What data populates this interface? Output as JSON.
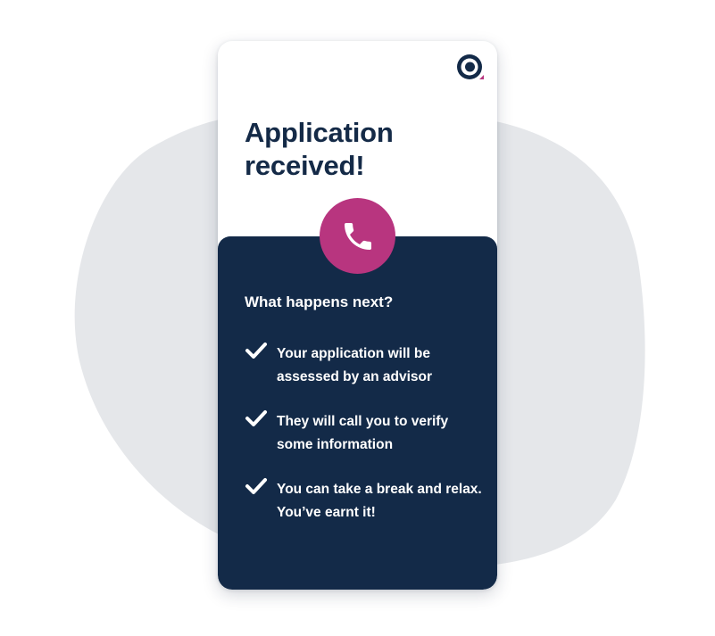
{
  "colors": {
    "navy": "#132a48",
    "title": "#142a47",
    "accent": "#b8357f",
    "blob": "#e5e7ea",
    "white": "#ffffff"
  },
  "app": {
    "logo_icon": "brand-logo-icon"
  },
  "header": {
    "title": "Application received!"
  },
  "badge": {
    "icon": "phone-icon"
  },
  "next": {
    "heading": "What happens next?",
    "steps": [
      {
        "icon": "checkmark-icon",
        "text": "Your application will be assessed by an advisor"
      },
      {
        "icon": "checkmark-icon",
        "text": "They will call you to verify some information"
      },
      {
        "icon": "checkmark-icon",
        "text": "You can take a break and relax. You’ve earnt it!"
      }
    ]
  }
}
